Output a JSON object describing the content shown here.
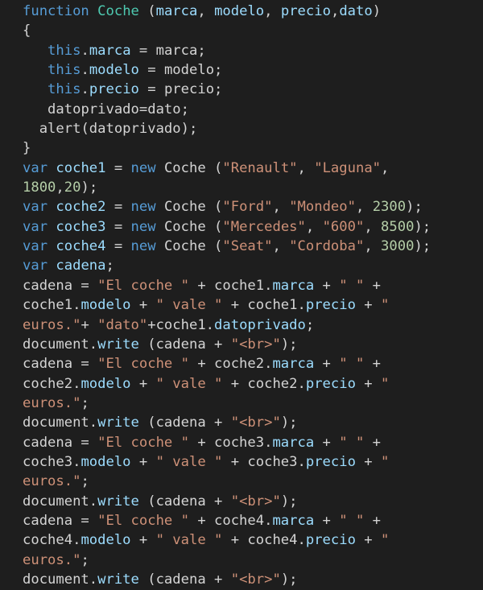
{
  "editor": {
    "background": "#1e1e1e",
    "colors": {
      "keyword": "#569cd6",
      "function_name": "#4ec9b0",
      "identifier": "#9cdcfe",
      "string": "#ce9178",
      "number": "#b5cea8",
      "plain": "#d4d4d4"
    },
    "lines": [
      [
        [
          "kw",
          "function"
        ],
        [
          "txt",
          " "
        ],
        [
          "cls",
          "Coche"
        ],
        [
          "txt",
          " ("
        ],
        [
          "id",
          "marca"
        ],
        [
          "txt",
          ", "
        ],
        [
          "id",
          "modelo"
        ],
        [
          "txt",
          ", "
        ],
        [
          "id",
          "precio"
        ],
        [
          "txt",
          ","
        ],
        [
          "id",
          "dato"
        ],
        [
          "txt",
          ")"
        ]
      ],
      [
        [
          "txt",
          "{"
        ]
      ],
      [
        [
          "txt",
          "   "
        ],
        [
          "kw",
          "this"
        ],
        [
          "txt",
          "."
        ],
        [
          "id",
          "marca"
        ],
        [
          "txt",
          " = "
        ],
        [
          "txt",
          "marca;"
        ]
      ],
      [
        [
          "txt",
          "   "
        ],
        [
          "kw",
          "this"
        ],
        [
          "txt",
          "."
        ],
        [
          "id",
          "modelo"
        ],
        [
          "txt",
          " = "
        ],
        [
          "txt",
          "modelo;"
        ]
      ],
      [
        [
          "txt",
          "   "
        ],
        [
          "kw",
          "this"
        ],
        [
          "txt",
          "."
        ],
        [
          "id",
          "precio"
        ],
        [
          "txt",
          " = "
        ],
        [
          "txt",
          "precio;"
        ]
      ],
      [
        [
          "txt",
          "   "
        ],
        [
          "txt",
          "datoprivado=dato;"
        ]
      ],
      [
        [
          "txt",
          "  "
        ],
        [
          "txt",
          "alert(datoprivado);"
        ]
      ],
      [
        [
          "txt",
          "}"
        ]
      ],
      [
        [
          "kw",
          "var"
        ],
        [
          "txt",
          " "
        ],
        [
          "id",
          "coche1"
        ],
        [
          "txt",
          " = "
        ],
        [
          "kw",
          "new"
        ],
        [
          "txt",
          " Coche ("
        ],
        [
          "str",
          "\"Renault\""
        ],
        [
          "txt",
          ", "
        ],
        [
          "str",
          "\"Laguna\""
        ],
        [
          "txt",
          ","
        ]
      ],
      [
        [
          "num",
          "1800"
        ],
        [
          "txt",
          ","
        ],
        [
          "num",
          "20"
        ],
        [
          "txt",
          ");"
        ]
      ],
      [
        [
          "kw",
          "var"
        ],
        [
          "txt",
          " "
        ],
        [
          "id",
          "coche2"
        ],
        [
          "txt",
          " = "
        ],
        [
          "kw",
          "new"
        ],
        [
          "txt",
          " Coche ("
        ],
        [
          "str",
          "\"Ford\""
        ],
        [
          "txt",
          ", "
        ],
        [
          "str",
          "\"Mondeo\""
        ],
        [
          "txt",
          ", "
        ],
        [
          "num",
          "2300"
        ],
        [
          "txt",
          ");"
        ]
      ],
      [
        [
          "kw",
          "var"
        ],
        [
          "txt",
          " "
        ],
        [
          "id",
          "coche3"
        ],
        [
          "txt",
          " = "
        ],
        [
          "kw",
          "new"
        ],
        [
          "txt",
          " Coche ("
        ],
        [
          "str",
          "\"Mercedes\""
        ],
        [
          "txt",
          ", "
        ],
        [
          "str",
          "\"600\""
        ],
        [
          "txt",
          ", "
        ],
        [
          "num",
          "8500"
        ],
        [
          "txt",
          ");"
        ]
      ],
      [
        [
          "kw",
          "var"
        ],
        [
          "txt",
          " "
        ],
        [
          "id",
          "coche4"
        ],
        [
          "txt",
          " = "
        ],
        [
          "kw",
          "new"
        ],
        [
          "txt",
          " Coche ("
        ],
        [
          "str",
          "\"Seat\""
        ],
        [
          "txt",
          ", "
        ],
        [
          "str",
          "\"Cordoba\""
        ],
        [
          "txt",
          ", "
        ],
        [
          "num",
          "3000"
        ],
        [
          "txt",
          ");"
        ]
      ],
      [
        [
          "kw",
          "var"
        ],
        [
          "txt",
          " "
        ],
        [
          "id",
          "cadena"
        ],
        [
          "txt",
          ";"
        ]
      ],
      [
        [
          "txt",
          "cadena = "
        ],
        [
          "str",
          "\"El coche \""
        ],
        [
          "txt",
          " + coche1."
        ],
        [
          "id",
          "marca"
        ],
        [
          "txt",
          " + "
        ],
        [
          "str",
          "\" \""
        ],
        [
          "txt",
          " +"
        ]
      ],
      [
        [
          "txt",
          "coche1."
        ],
        [
          "id",
          "modelo"
        ],
        [
          "txt",
          " + "
        ],
        [
          "str",
          "\" vale \""
        ],
        [
          "txt",
          " + coche1."
        ],
        [
          "id",
          "precio"
        ],
        [
          "txt",
          " + "
        ],
        [
          "str",
          "\""
        ]
      ],
      [
        [
          "str",
          "euros.\""
        ],
        [
          "txt",
          "+ "
        ],
        [
          "str",
          "\"dato\""
        ],
        [
          "txt",
          "+coche1."
        ],
        [
          "id",
          "datoprivado"
        ],
        [
          "txt",
          ";"
        ]
      ],
      [
        [
          "txt",
          "document."
        ],
        [
          "id",
          "write"
        ],
        [
          "txt",
          " (cadena + "
        ],
        [
          "str",
          "\"<br>\""
        ],
        [
          "txt",
          ");"
        ]
      ],
      [
        [
          "txt",
          "cadena = "
        ],
        [
          "str",
          "\"El coche \""
        ],
        [
          "txt",
          " + coche2."
        ],
        [
          "id",
          "marca"
        ],
        [
          "txt",
          " + "
        ],
        [
          "str",
          "\" \""
        ],
        [
          "txt",
          " +"
        ]
      ],
      [
        [
          "txt",
          "coche2."
        ],
        [
          "id",
          "modelo"
        ],
        [
          "txt",
          " + "
        ],
        [
          "str",
          "\" vale \""
        ],
        [
          "txt",
          " + coche2."
        ],
        [
          "id",
          "precio"
        ],
        [
          "txt",
          " + "
        ],
        [
          "str",
          "\""
        ]
      ],
      [
        [
          "str",
          "euros.\""
        ],
        [
          "txt",
          ";"
        ]
      ],
      [
        [
          "txt",
          "document."
        ],
        [
          "id",
          "write"
        ],
        [
          "txt",
          " (cadena + "
        ],
        [
          "str",
          "\"<br>\""
        ],
        [
          "txt",
          ");"
        ]
      ],
      [
        [
          "txt",
          "cadena = "
        ],
        [
          "str",
          "\"El coche \""
        ],
        [
          "txt",
          " + coche3."
        ],
        [
          "id",
          "marca"
        ],
        [
          "txt",
          " + "
        ],
        [
          "str",
          "\" \""
        ],
        [
          "txt",
          " +"
        ]
      ],
      [
        [
          "txt",
          "coche3."
        ],
        [
          "id",
          "modelo"
        ],
        [
          "txt",
          " + "
        ],
        [
          "str",
          "\" vale \""
        ],
        [
          "txt",
          " + coche3."
        ],
        [
          "id",
          "precio"
        ],
        [
          "txt",
          " + "
        ],
        [
          "str",
          "\""
        ]
      ],
      [
        [
          "str",
          "euros.\""
        ],
        [
          "txt",
          ";"
        ]
      ],
      [
        [
          "txt",
          "document."
        ],
        [
          "id",
          "write"
        ],
        [
          "txt",
          " (cadena + "
        ],
        [
          "str",
          "\"<br>\""
        ],
        [
          "txt",
          ");"
        ]
      ],
      [
        [
          "txt",
          "cadena = "
        ],
        [
          "str",
          "\"El coche \""
        ],
        [
          "txt",
          " + coche4."
        ],
        [
          "id",
          "marca"
        ],
        [
          "txt",
          " + "
        ],
        [
          "str",
          "\" \""
        ],
        [
          "txt",
          " +"
        ]
      ],
      [
        [
          "txt",
          "coche4."
        ],
        [
          "id",
          "modelo"
        ],
        [
          "txt",
          " + "
        ],
        [
          "str",
          "\" vale \""
        ],
        [
          "txt",
          " + coche4."
        ],
        [
          "id",
          "precio"
        ],
        [
          "txt",
          " + "
        ],
        [
          "str",
          "\""
        ]
      ],
      [
        [
          "str",
          "euros.\""
        ],
        [
          "txt",
          ";"
        ]
      ],
      [
        [
          "txt",
          "document."
        ],
        [
          "id",
          "write"
        ],
        [
          "txt",
          " (cadena + "
        ],
        [
          "str",
          "\"<br>\""
        ],
        [
          "txt",
          ");"
        ]
      ]
    ]
  }
}
